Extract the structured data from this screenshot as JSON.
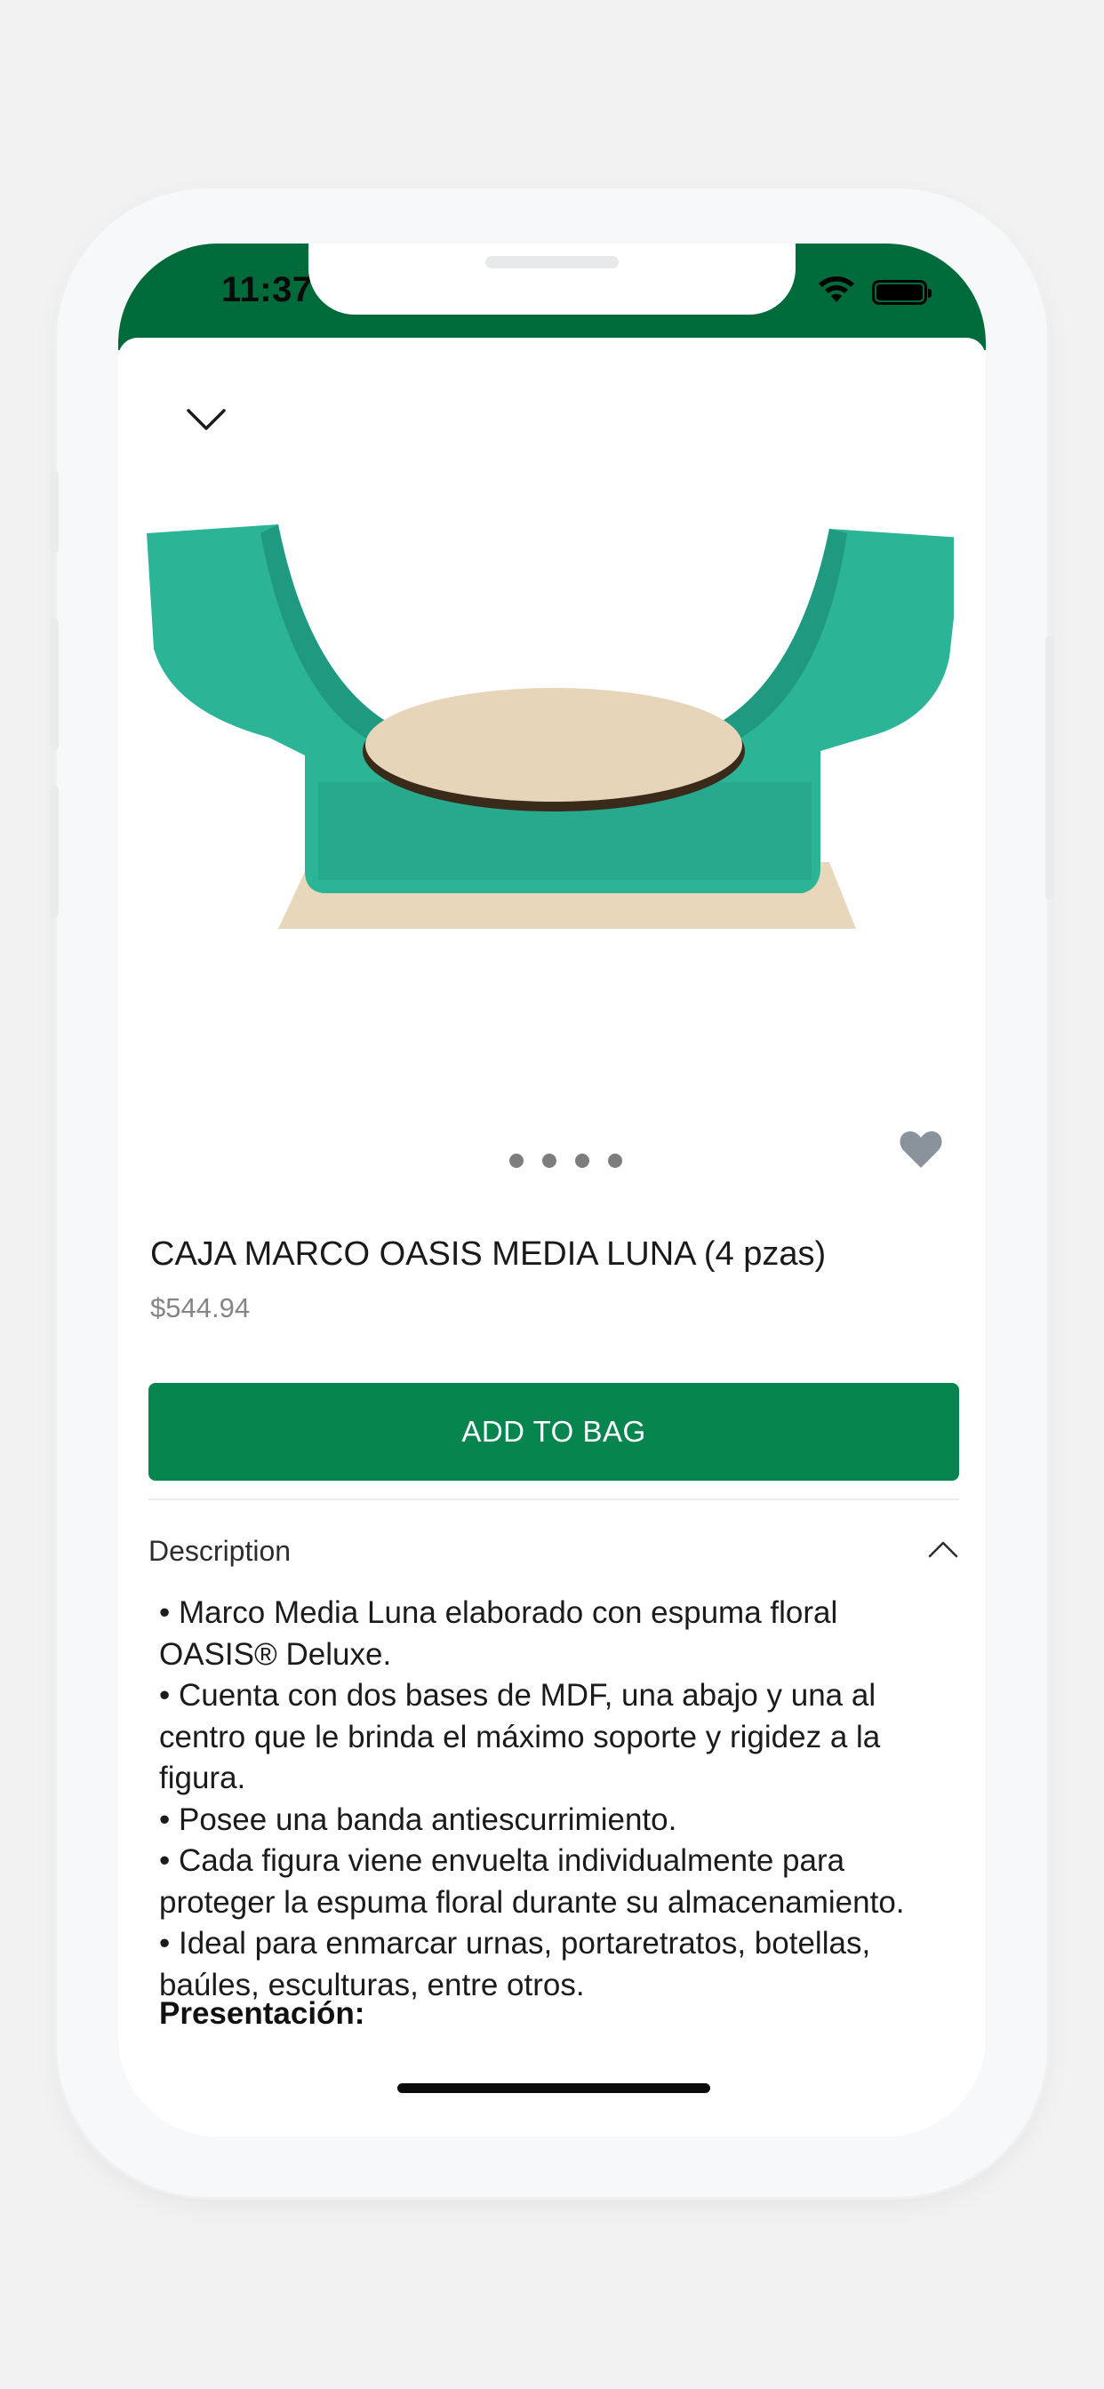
{
  "status_bar": {
    "time": "11:37",
    "background_color": "#006b3a",
    "icons": [
      "wifi-icon",
      "battery-icon"
    ]
  },
  "header": {
    "close_icon": "chevron-down-icon"
  },
  "product": {
    "image_description_icon": "product-image",
    "carousel_pages": 4,
    "title": "CAJA MARCO OASIS MEDIA LUNA (4 pzas)",
    "price": "$544.94",
    "favorite_icon": "heart-icon",
    "favorite_color": "#8a939c"
  },
  "actions": {
    "add_to_bag_label": "ADD TO BAG",
    "add_to_bag_color": "#06854f"
  },
  "description": {
    "label": "Description",
    "toggle_icon": "chevron-up-icon",
    "bullets": [
      "• Marco Media Luna elaborado con espuma floral OASIS® Deluxe.",
      "• Cuenta con dos bases de MDF, una abajo y una al centro que le brinda el máximo soporte y rigidez a la figura.",
      "• Posee una banda antiescurrimiento.",
      "• Cada figura viene envuelta individualmente para proteger la espuma floral durante su almacenamiento.",
      "• Ideal para enmarcar urnas, portaretratos, botellas, baúles, esculturas, entre otros."
    ],
    "presentacion_label": "Presentación:"
  }
}
